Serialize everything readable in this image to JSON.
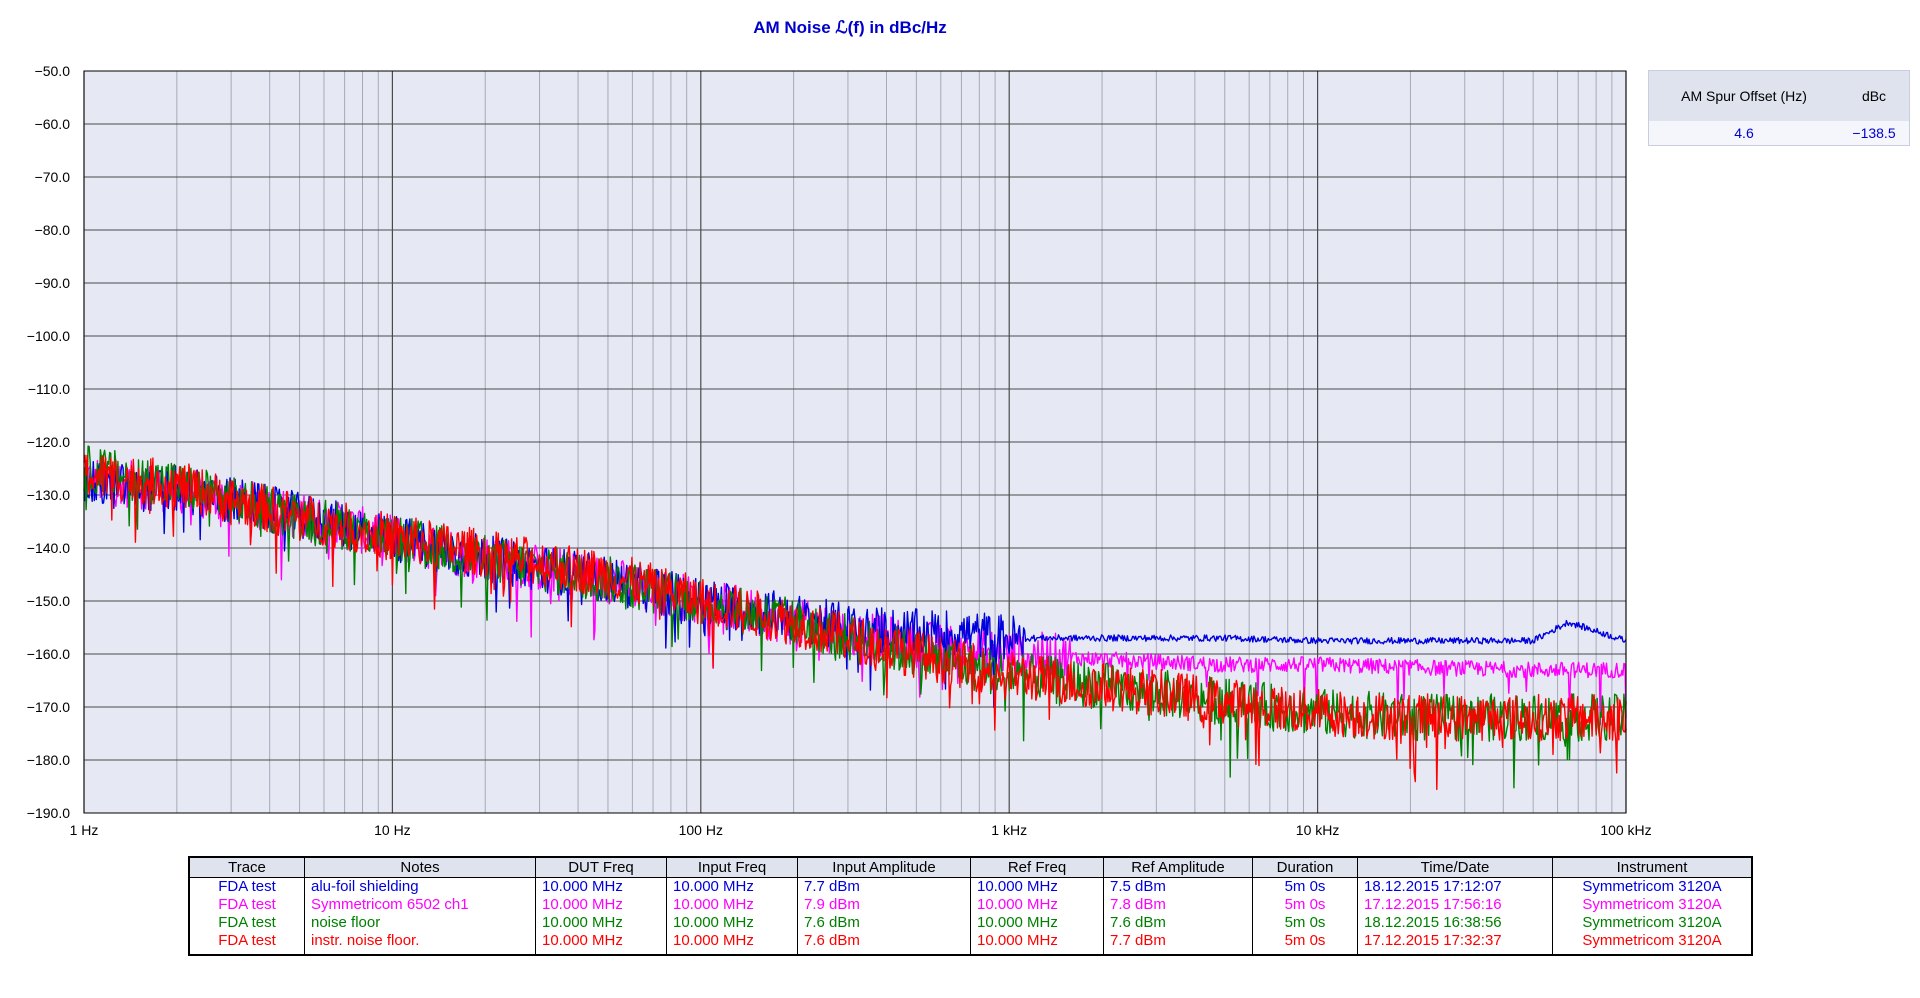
{
  "chart_data": {
    "type": "line",
    "title": "AM Noise ℒ(f) in dBc/Hz",
    "x_scale": "log",
    "xlim_hz": [
      1,
      100000
    ],
    "ylim": [
      -190,
      -50
    ],
    "y_ticks": [
      -50,
      -60,
      -70,
      -80,
      -90,
      -100,
      -110,
      -120,
      -130,
      -140,
      -150,
      -160,
      -170,
      -180,
      -190
    ],
    "y_tick_labels": [
      "−50.0",
      "−60.0",
      "−70.0",
      "−80.0",
      "−90.0",
      "−100.0",
      "−110.0",
      "−120.0",
      "−130.0",
      "−140.0",
      "−150.0",
      "−160.0",
      "−170.0",
      "−180.0",
      "−190.0"
    ],
    "x_ticks_hz": [
      1,
      10,
      100,
      1000,
      10000,
      100000
    ],
    "x_tick_labels": [
      "1 Hz",
      "10 Hz",
      "100 Hz",
      "1 kHz",
      "10 kHz",
      "100 kHz"
    ],
    "grid": true,
    "series": [
      {
        "name": "alu-foil shielding",
        "color": "#0000dd",
        "x": [
          1,
          2,
          3,
          5,
          10,
          20,
          50,
          100,
          200,
          300,
          500,
          700,
          1000,
          2000,
          5000,
          10000,
          20000,
          50000,
          65000,
          100000
        ],
        "y": [
          -128,
          -129,
          -131,
          -134,
          -138,
          -142,
          -146,
          -150,
          -153,
          -155,
          -156,
          -156,
          -157,
          -157,
          -157,
          -157.5,
          -157.5,
          -157.5,
          -154,
          -157.5
        ]
      },
      {
        "name": "Symmetricom 6502 ch1",
        "color": "#ff00ff",
        "x": [
          1,
          2,
          3,
          5,
          10,
          20,
          50,
          100,
          200,
          300,
          500,
          700,
          1000,
          2000,
          5000,
          10000,
          20000,
          50000,
          100000
        ],
        "y": [
          -127,
          -129,
          -131,
          -134,
          -138,
          -142,
          -146,
          -150,
          -154,
          -156,
          -158,
          -159,
          -160,
          -161,
          -162,
          -162,
          -162.5,
          -163,
          -163
        ]
      },
      {
        "name": "noise floor",
        "color": "#008000",
        "x": [
          1,
          2,
          3,
          5,
          10,
          20,
          50,
          100,
          200,
          300,
          500,
          700,
          1000,
          2000,
          5000,
          10000,
          20000,
          50000,
          100000
        ],
        "y": [
          -125,
          -128,
          -131,
          -134,
          -138,
          -142,
          -146,
          -150,
          -154,
          -157,
          -160,
          -162,
          -164,
          -166,
          -169,
          -171,
          -172,
          -172,
          -172
        ]
      },
      {
        "name": "instr. noise floor.",
        "color": "#ff0000",
        "x": [
          1,
          2,
          3,
          5,
          10,
          20,
          50,
          100,
          200,
          300,
          500,
          700,
          1000,
          2000,
          5000,
          10000,
          20000,
          50000,
          100000
        ],
        "y": [
          -126,
          -128,
          -131,
          -134,
          -138,
          -141,
          -145,
          -150,
          -154,
          -157,
          -160,
          -162,
          -164,
          -166,
          -169,
          -171,
          -172,
          -172,
          -172
        ]
      }
    ]
  },
  "spur_table": {
    "headers": [
      "AM Spur Offset (Hz)",
      "dBc"
    ],
    "rows": [
      [
        "4.6",
        "−138.5"
      ]
    ]
  },
  "legend_table": {
    "headers": [
      "Trace",
      "Notes",
      "DUT Freq",
      "Input Freq",
      "Input Amplitude",
      "Ref Freq",
      "Ref Amplitude",
      "Duration",
      "Time/Date",
      "Instrument"
    ],
    "rows": [
      {
        "color": "#0000dd",
        "cells": [
          "FDA test",
          "alu-foil shielding",
          "10.000 MHz",
          "10.000 MHz",
          "7.7 dBm",
          "10.000 MHz",
          "7.5 dBm",
          "5m 0s",
          "18.12.2015 17:12:07",
          "Symmetricom 3120A"
        ]
      },
      {
        "color": "#ff00ff",
        "cells": [
          "FDA test",
          "Symmetricom 6502 ch1",
          "10.000 MHz",
          "10.000 MHz",
          "7.9 dBm",
          "10.000 MHz",
          "7.8 dBm",
          "5m 0s",
          "17.12.2015 17:56:16",
          "Symmetricom 3120A"
        ]
      },
      {
        "color": "#008000",
        "cells": [
          "FDA test",
          "noise floor",
          "10.000 MHz",
          "10.000 MHz",
          "7.6 dBm",
          "10.000 MHz",
          "7.6 dBm",
          "5m 0s",
          "18.12.2015 16:38:56",
          "Symmetricom 3120A"
        ]
      },
      {
        "color": "#ff0000",
        "cells": [
          "FDA test",
          "instr. noise floor.",
          "10.000 MHz",
          "10.000 MHz",
          "7.6 dBm",
          "10.000 MHz",
          "7.7 dBm",
          "5m 0s",
          "17.12.2015 17:32:37",
          "Symmetricom 3120A"
        ]
      }
    ]
  }
}
